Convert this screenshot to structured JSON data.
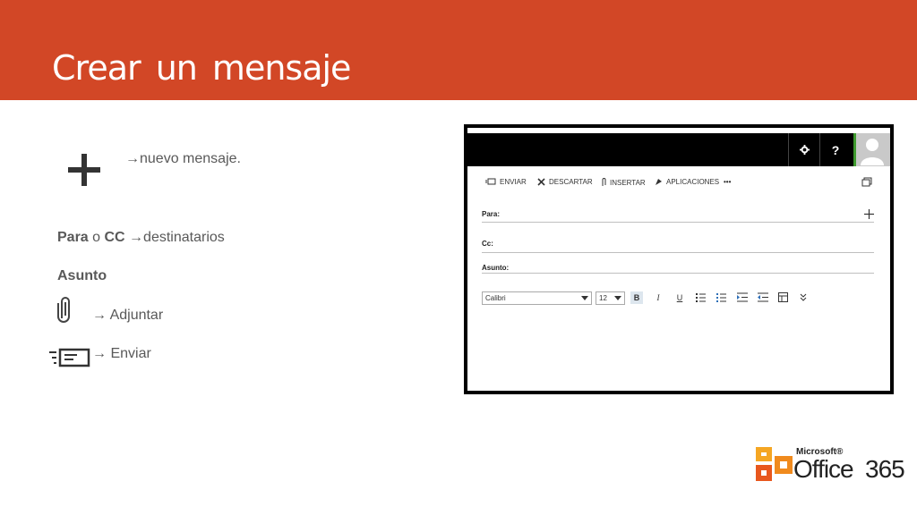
{
  "slide": {
    "title": "Crear  un  mensaje",
    "new_message": "→nuevo mensaje.",
    "para": "Para",
    "o": " o ",
    "cc": "CC",
    "destinatarios": " →destinatarios",
    "asunto": "Asunto",
    "adjuntar": "→ Adjuntar",
    "enviar": "→ Enviar"
  },
  "screenshot": {
    "topbar": {
      "settings_icon": "gear-icon",
      "help_label": "?",
      "avatar": "user-avatar"
    },
    "toolbar": {
      "send": "ENVIAR",
      "discard": "DESCARTAR",
      "insert": "INSERTAR",
      "apps": "APLICACIONES",
      "more": "•••"
    },
    "fields": {
      "to": "Para:",
      "cc": "Cc:",
      "subject": "Asunto:"
    },
    "format": {
      "font": "Calibri",
      "size": "12",
      "bold": "B",
      "italic": "I",
      "underline": "U"
    }
  },
  "logo": {
    "microsoft": "Microsoft®",
    "office": "Office",
    "version": "365"
  },
  "colors": {
    "accent": "#d24726",
    "text": "#595959"
  }
}
